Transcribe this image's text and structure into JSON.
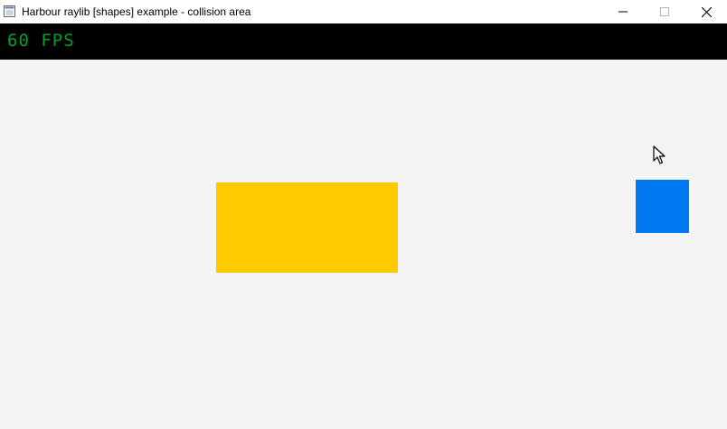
{
  "window": {
    "title": "Harbour raylib [shapes] example - collision area",
    "icon": "app-icon",
    "controls": {
      "minimize_icon": "minimize-icon",
      "maximize_icon": "maximize-icon",
      "close_icon": "close-icon"
    }
  },
  "hud": {
    "fps_text": "60 FPS",
    "fps_color": "#009e2f",
    "bar_color": "#000000"
  },
  "scene": {
    "background_color": "#f4f4f4",
    "static_rect_color": "#ffcb00",
    "moving_box_color": "#0079f1",
    "cursor_icon": "mouse-pointer-icon"
  }
}
